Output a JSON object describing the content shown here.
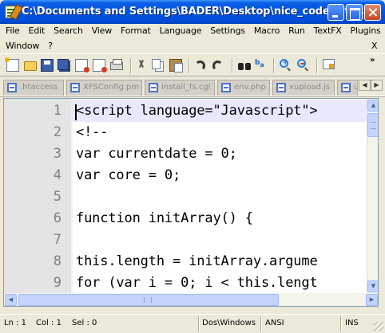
{
  "window": {
    "title": "C:\\Documents and Settings\\BADER\\Desktop\\nice_code.txt - ..."
  },
  "menu": {
    "row1": [
      "File",
      "Edit",
      "Search",
      "View",
      "Format",
      "Language",
      "Settings",
      "Macro",
      "Run",
      "TextFX",
      "Plugins"
    ],
    "row2": [
      "Window",
      "?"
    ],
    "close_glyph": "X"
  },
  "toolbar": {
    "icons": [
      "new-file-icon",
      "open-folder-icon",
      "save-icon",
      "save-all-icon",
      "close-file-icon",
      "close-all-icon",
      "print-icon",
      "cut-icon",
      "copy-icon",
      "paste-icon",
      "undo-icon",
      "redo-icon",
      "find-icon",
      "replace-icon",
      "zoom-in-icon",
      "zoom-out-icon",
      "sync-view-icon"
    ],
    "overflow": "»"
  },
  "tabs": [
    {
      "label": ".htaccess"
    },
    {
      "label": "XFSConfig.pm"
    },
    {
      "label": "install_fs.cgi"
    },
    {
      "label": "env.php"
    },
    {
      "label": "xupload.js"
    },
    {
      "label": "u"
    }
  ],
  "tab_scroll": {
    "left": "◀",
    "right": "▶"
  },
  "editor": {
    "lines": [
      {
        "num": "1",
        "code": "<script language=\"Javascript\">",
        "current": true
      },
      {
        "num": "2",
        "code": "<!--"
      },
      {
        "num": "3",
        "code": "var currentdate = 0;"
      },
      {
        "num": "4",
        "code": "var core = 0;"
      },
      {
        "num": "5",
        "code": ""
      },
      {
        "num": "6",
        "code": "function initArray() {"
      },
      {
        "num": "7",
        "code": ""
      },
      {
        "num": "8",
        "code": "this.length = initArray.argume"
      },
      {
        "num": "9",
        "code": "for (var i = 0; i < this.lengt"
      }
    ],
    "scroll_up": "▲",
    "scroll_down": "▼",
    "scroll_left": "◀",
    "scroll_right": "▶"
  },
  "status": {
    "ln": "Ln : 1",
    "col": "Col : 1",
    "sel": "Sel : 0",
    "eol": "Dos\\Windows",
    "encoding": "ANSI",
    "mode": "INS"
  },
  "colors": {
    "title_blue": "#0054e3",
    "current_line": "#e8e8ff",
    "gutter": "#e4e4e4",
    "line_number": "#808080"
  }
}
